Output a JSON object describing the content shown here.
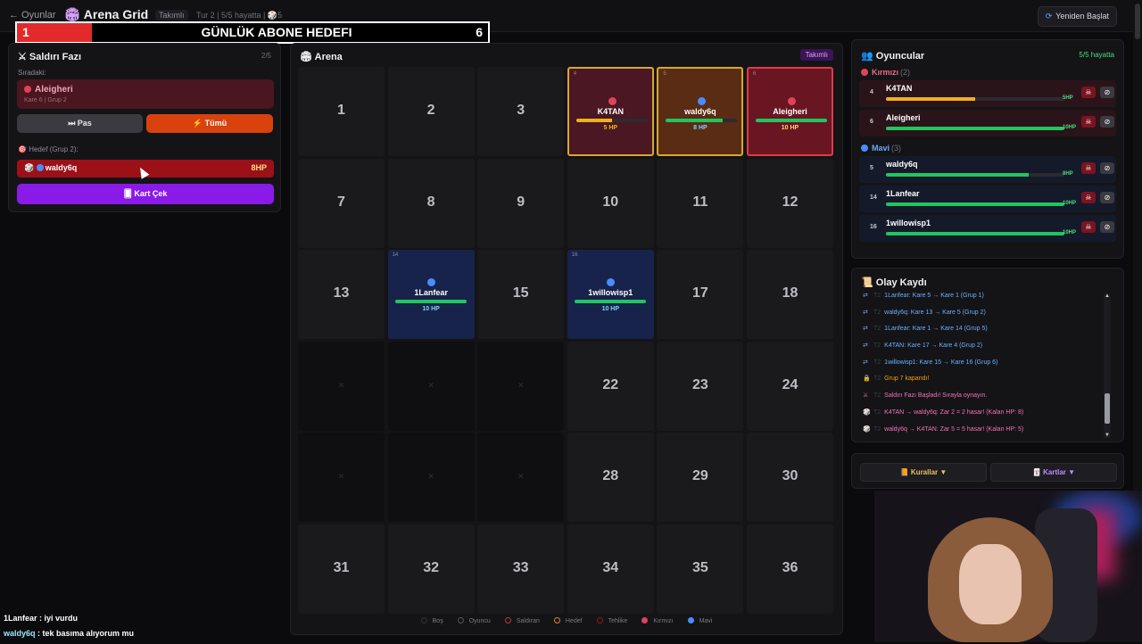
{
  "topbar": {
    "back_label": "← Oyunlar",
    "title": "Arena Grid",
    "mode_badge": "Takımlı",
    "turn_info": "Tur 2 | 5/5 hayatta | 🎲5",
    "restart_label": "Yeniden Başlat"
  },
  "banner": {
    "left_value": "1",
    "title": "GÜNLÜK ABONE HEDEFI",
    "right_value": "6",
    "progress": 0.167
  },
  "attack_panel": {
    "title": "Saldırı Fazı",
    "counter": "2/5",
    "next_label": "Sıradaki:",
    "current_player": {
      "name": "Aleigheri",
      "meta": "Kare 6 | Grup 2"
    },
    "pass_label": "Pas",
    "all_label": "Tümü",
    "target_label": "Hedef (Grup 2):",
    "target": {
      "name": "waldy6q",
      "hp": "8HP"
    },
    "draw_card_label": "Kart Çek"
  },
  "arena": {
    "title": "Arena",
    "mode_tag": "Takımlı",
    "cells": [
      {
        "n": "1"
      },
      {
        "n": "2"
      },
      {
        "n": "3"
      },
      {
        "n": "4",
        "player": "K4TAN",
        "hp": "5 HP",
        "hp_frac": 0.5,
        "team": "red",
        "style": "k4"
      },
      {
        "n": "5",
        "player": "waldy6q",
        "hp": "8 HP",
        "hp_frac": 0.8,
        "team": "blue",
        "style": "wa"
      },
      {
        "n": "6",
        "player": "Aleigheri",
        "hp": "10 HP",
        "hp_frac": 1.0,
        "team": "red",
        "style": "al"
      },
      {
        "n": "7"
      },
      {
        "n": "8"
      },
      {
        "n": "9"
      },
      {
        "n": "10"
      },
      {
        "n": "11"
      },
      {
        "n": "12"
      },
      {
        "n": "13"
      },
      {
        "n": "14",
        "player": "1Lanfear",
        "hp": "10 HP",
        "hp_frac": 1.0,
        "team": "blue",
        "style": "blue"
      },
      {
        "n": "15"
      },
      {
        "n": "16",
        "player": "1willowisp1",
        "hp": "10 HP",
        "hp_frac": 1.0,
        "team": "blue",
        "style": "blue"
      },
      {
        "n": "17"
      },
      {
        "n": "18"
      },
      {
        "n": "×",
        "blocked": true
      },
      {
        "n": "×",
        "blocked": true
      },
      {
        "n": "×",
        "blocked": true
      },
      {
        "n": "22"
      },
      {
        "n": "23"
      },
      {
        "n": "24"
      },
      {
        "n": "×",
        "blocked": true
      },
      {
        "n": "×",
        "blocked": true
      },
      {
        "n": "×",
        "blocked": true
      },
      {
        "n": "28"
      },
      {
        "n": "29"
      },
      {
        "n": "30"
      },
      {
        "n": "31"
      },
      {
        "n": "32"
      },
      {
        "n": "33"
      },
      {
        "n": "34"
      },
      {
        "n": "35"
      },
      {
        "n": "36"
      }
    ],
    "legend": [
      "Boş",
      "Oyuncu",
      "Saldıran",
      "Hedef",
      "Tehlike",
      "Kırmızı",
      "Mavi"
    ]
  },
  "players_panel": {
    "title": "Oyuncular",
    "alive": "5/5 hayatta",
    "teams": [
      {
        "name": "Kırmızı",
        "count": "(2)",
        "color": "#e0425a",
        "players": [
          {
            "sq": "4",
            "name": "K4TAN",
            "hp": "5HP",
            "frac": 0.5,
            "bar": "#f0b020"
          },
          {
            "sq": "6",
            "name": "Aleigheri",
            "hp": "10HP",
            "frac": 1.0,
            "bar": "#22c55e"
          }
        ]
      },
      {
        "name": "Mavi",
        "count": "(3)",
        "color": "#4a8cff",
        "players": [
          {
            "sq": "5",
            "name": "waldy6q",
            "hp": "8HP",
            "frac": 0.8,
            "bar": "#22c55e"
          },
          {
            "sq": "14",
            "name": "1Lanfear",
            "hp": "10HP",
            "frac": 1.0,
            "bar": "#22c55e"
          },
          {
            "sq": "16",
            "name": "1willowisp1",
            "hp": "10HP",
            "frac": 1.0,
            "bar": "#22c55e"
          }
        ]
      }
    ]
  },
  "event_log": {
    "title": "Olay Kaydı",
    "items": [
      {
        "icon": "move-icon",
        "t": "T2",
        "text": "1Lanfear: Kare 5 → Kare 1 (Grup 1)",
        "color": "#6ab0ff"
      },
      {
        "icon": "move-icon",
        "t": "T2",
        "text": "waldy6q: Kare 13 → Kare 5 (Grup 2)",
        "color": "#6ab0ff"
      },
      {
        "icon": "move-icon",
        "t": "T2",
        "text": "1Lanfear: Kare 1 → Kare 14 (Grup 5)",
        "color": "#6ab0ff"
      },
      {
        "icon": "move-icon",
        "t": "T2",
        "text": "K4TAN: Kare 17 → Kare 4 (Grup 2)",
        "color": "#6ab0ff"
      },
      {
        "icon": "move-icon",
        "t": "T2",
        "text": "1willowisp1: Kare 15 → Kare 16 (Grup 6)",
        "color": "#6ab0ff"
      },
      {
        "icon": "lock-icon",
        "t": "T2",
        "text": "Grup 7 kapandı!",
        "color": "#f59e0b"
      },
      {
        "icon": "swords-icon",
        "t": "T2",
        "text": "Saldırı Fazı Başladı! Sırayla oynayın.",
        "color": "#f472b6"
      },
      {
        "icon": "dice-icon",
        "t": "T2",
        "text": "K4TAN → waldy6q: Zar 2 = 2 hasar! (Kalan HP: 8)",
        "color": "#f472b6"
      },
      {
        "icon": "dice-icon",
        "t": "T2",
        "text": "waldy6q → K4TAN: Zar 5 = 5 hasar! (Kalan HP: 5)",
        "color": "#f472b6"
      }
    ]
  },
  "bottom_tabs": {
    "rules_label": "Kurallar ▼",
    "cards_label": "Kartlar ▼"
  },
  "chat": [
    {
      "user": "1Lanfear",
      "msg": " : iyi vurdu"
    },
    {
      "user": "waldy6q",
      "msg": " : tek basıma alıyorum mu"
    }
  ],
  "colors": {
    "red_team": "#e0425a",
    "blue_team": "#4a8cff",
    "accent_purple": "#8a1ae8",
    "accent_orange": "#d9420c"
  }
}
